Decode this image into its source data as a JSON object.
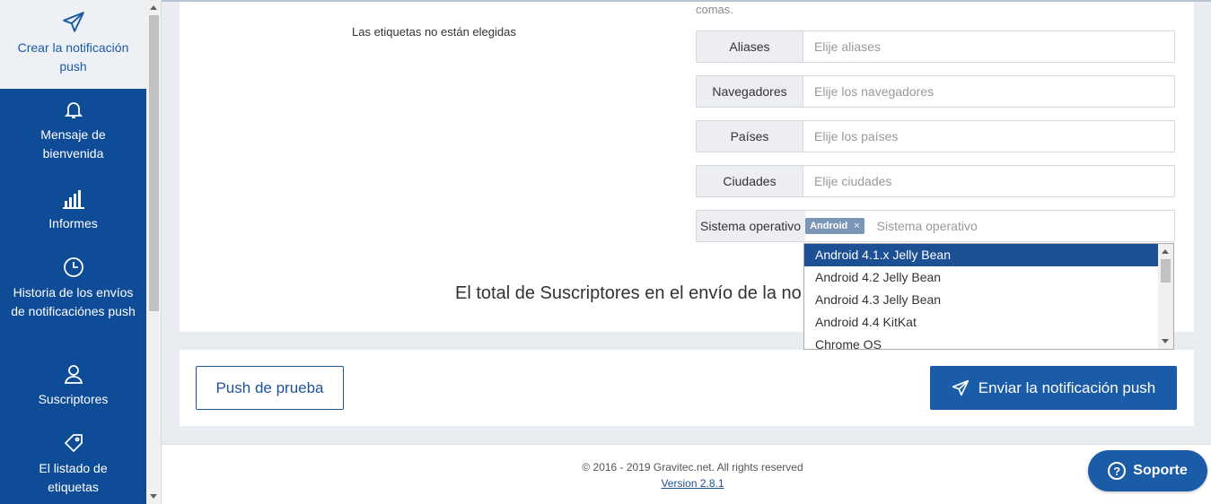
{
  "sidebar": {
    "items": [
      {
        "label": "Crear la notificación push",
        "icon": "paper-plane-icon"
      },
      {
        "label": "Mensaje de bienvenida",
        "icon": "bell-icon"
      },
      {
        "label": "Informes",
        "icon": "bar-chart-icon"
      },
      {
        "label": "Historia de los envíos de notificaciónes push",
        "icon": "clock-icon"
      },
      {
        "label": "Suscriptores",
        "icon": "user-icon"
      },
      {
        "label": "El listado de etiquetas",
        "icon": "tag-icon"
      }
    ]
  },
  "main": {
    "comas_text": "comas.",
    "tags_empty": "Las etiquetas no están elegidas",
    "filters": [
      {
        "label": "Aliases",
        "placeholder": "Elije aliases"
      },
      {
        "label": "Navegadores",
        "placeholder": "Elije los navegadores"
      },
      {
        "label": "Países",
        "placeholder": "Elije los países"
      },
      {
        "label": "Ciudades",
        "placeholder": "Elije ciudades"
      }
    ],
    "os_filter": {
      "label": "Sistema operativo",
      "chip": "Android",
      "chip_remove": "×",
      "placeholder": "Sistema operativo"
    },
    "os_options": [
      "Android 4.1.x Jelly Bean",
      "Android 4.2 Jelly Bean",
      "Android 4.3 Jelly Bean",
      "Android 4.4 KitKat",
      "Chrome OS"
    ],
    "total_subscribers_text": "El total de Suscriptores en el envío de la no"
  },
  "actions": {
    "test_push": "Push de prueba",
    "send_push": "Enviar la notificación push"
  },
  "footer": {
    "copyright": "© 2016 - 2019 Gravitec.net. All rights reserved",
    "version": "Version 2.8.1"
  },
  "support": {
    "label": "Soporte"
  },
  "colors": {
    "sidebar": "#0f4c97",
    "primary": "#1b5ca8",
    "selected_option": "#1c4f93",
    "chip": "#7b96b8"
  }
}
